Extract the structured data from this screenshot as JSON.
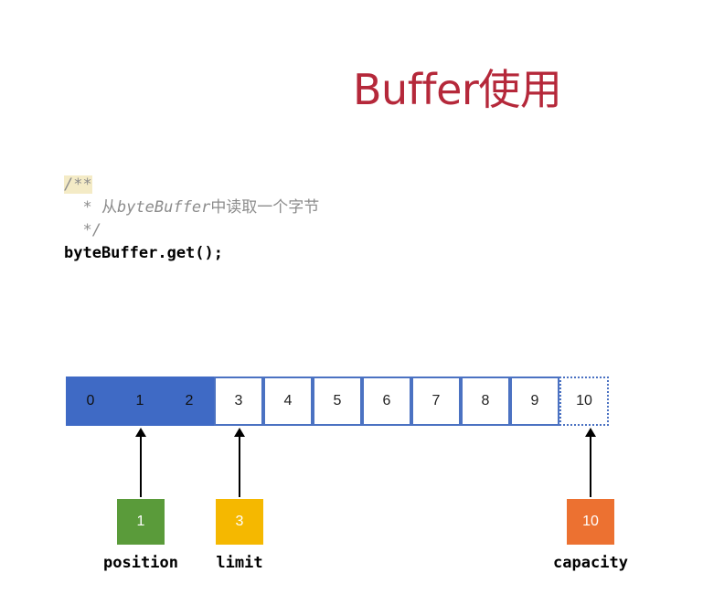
{
  "slide": {
    "title": "Buffer使用"
  },
  "code": {
    "comment_open": "/**",
    "comment_body_prefix": "  * ",
    "comment_body_text_1": "从",
    "comment_body_italic": "byteBuffer",
    "comment_body_text_2": "中读取一个字节",
    "comment_close": "  */",
    "statement": "byteBuffer.get();"
  },
  "buffer": {
    "cells": [
      "0",
      "1",
      "2",
      "3",
      "4",
      "5",
      "6",
      "7",
      "8",
      "9",
      "10"
    ],
    "read_count": 3,
    "capacity_dotted_index": 10,
    "colors": {
      "filled": "#3f6ac5",
      "border": "#4b72c2"
    }
  },
  "markers": {
    "position": {
      "value": "1",
      "label": "position",
      "index": 1,
      "color": "#5a9b3a"
    },
    "limit": {
      "value": "3",
      "label": "limit",
      "index": 3,
      "color": "#f5b800"
    },
    "capacity": {
      "value": "10",
      "label": "capacity",
      "index": 10,
      "color": "#ec7131"
    }
  }
}
